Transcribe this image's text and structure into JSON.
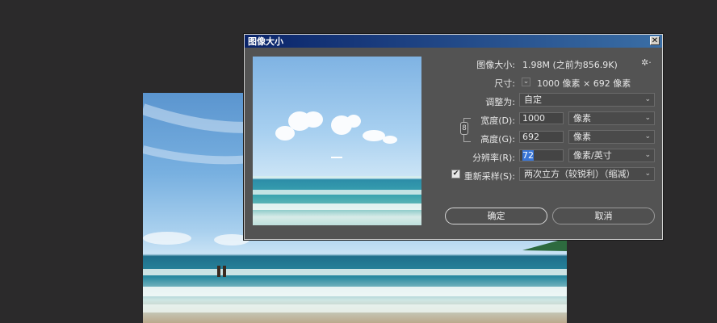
{
  "dialog": {
    "title": "图像大小",
    "close_label": "✕",
    "image_size_label": "图像大小:",
    "image_size_value": "1.98M (之前为856.9K)",
    "dimensions_label": "尺寸:",
    "dimensions_value": "1000 像素 × 692 像素",
    "fit_to_label": "调整为:",
    "fit_to_value": "自定",
    "width_label": "宽度(D):",
    "width_value": "1000",
    "width_unit": "像素",
    "height_label": "高度(G):",
    "height_value": "692",
    "height_unit": "像素",
    "resolution_label": "分辨率(R):",
    "resolution_value": "72",
    "resolution_unit": "像素/英寸",
    "resample_label": "重新采样(S):",
    "resample_checked": true,
    "resample_value": "两次立方（较锐利）（缩减）",
    "ok_label": "确定",
    "cancel_label": "取消"
  },
  "icons": {
    "gear": "gear-icon",
    "link": "chain-link-icon",
    "chevron": "chevron-down-icon"
  },
  "colors": {
    "titlebar_start": "#0a246a",
    "titlebar_end": "#3a6ea5",
    "dialog_bg": "#535353",
    "canvas_bg": "#2b2a2b"
  }
}
